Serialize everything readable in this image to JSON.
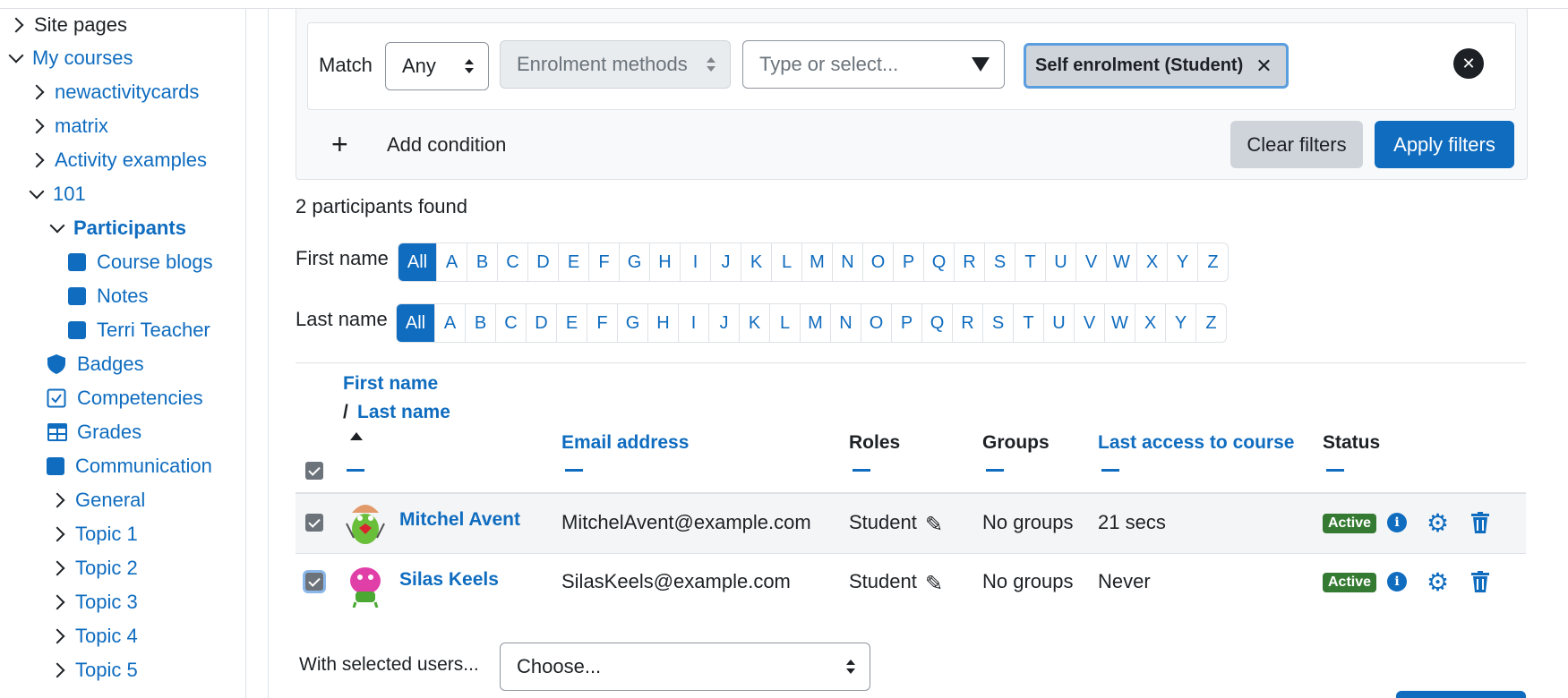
{
  "sidebar": {
    "site_pages": "Site pages",
    "my_courses": "My courses",
    "items": [
      {
        "label": "newactivitycards"
      },
      {
        "label": "matrix"
      },
      {
        "label": "Activity examples"
      },
      {
        "label": "101"
      },
      {
        "label": "Participants"
      },
      {
        "label": "Course blogs"
      },
      {
        "label": "Notes"
      },
      {
        "label": "Terri Teacher"
      },
      {
        "label": "Badges"
      },
      {
        "label": "Competencies"
      },
      {
        "label": "Grades"
      },
      {
        "label": "Communication"
      },
      {
        "label": "General"
      },
      {
        "label": "Topic 1"
      },
      {
        "label": "Topic 2"
      },
      {
        "label": "Topic 3"
      },
      {
        "label": "Topic 4"
      },
      {
        "label": "Topic 5"
      }
    ]
  },
  "filter": {
    "match_label": "Match",
    "match_value": "Any",
    "type_value": "Enrolment methods",
    "value_placeholder": "Type or select...",
    "selected_chip": "Self enrolment (Student)",
    "add_condition": "Add condition",
    "clear_filters": "Clear filters",
    "apply_filters": "Apply filters"
  },
  "participants_found": "2 participants found",
  "initials": {
    "first_label": "First name",
    "last_label": "Last name",
    "letters": [
      "All",
      "A",
      "B",
      "C",
      "D",
      "E",
      "F",
      "G",
      "H",
      "I",
      "J",
      "K",
      "L",
      "M",
      "N",
      "O",
      "P",
      "Q",
      "R",
      "S",
      "T",
      "U",
      "V",
      "W",
      "X",
      "Y",
      "Z"
    ]
  },
  "table": {
    "headers": {
      "first_name": "First name",
      "slash": "/",
      "last_name": "Last name",
      "email": "Email address",
      "roles": "Roles",
      "groups": "Groups",
      "last_access": "Last access to course",
      "status": "Status"
    },
    "rows": [
      {
        "name": "Mitchel Avent",
        "email": "MitchelAvent@example.com",
        "role": "Student",
        "groups": "No groups",
        "last_access": "21 secs",
        "status": "Active"
      },
      {
        "name": "Silas Keels",
        "email": "SilasKeels@example.com",
        "role": "Student",
        "groups": "No groups",
        "last_access": "Never",
        "status": "Active"
      }
    ]
  },
  "bulk": {
    "label": "With selected users...",
    "select_value": "Choose..."
  },
  "colors": {
    "primary": "#0f6cbf",
    "success": "#357a32"
  }
}
